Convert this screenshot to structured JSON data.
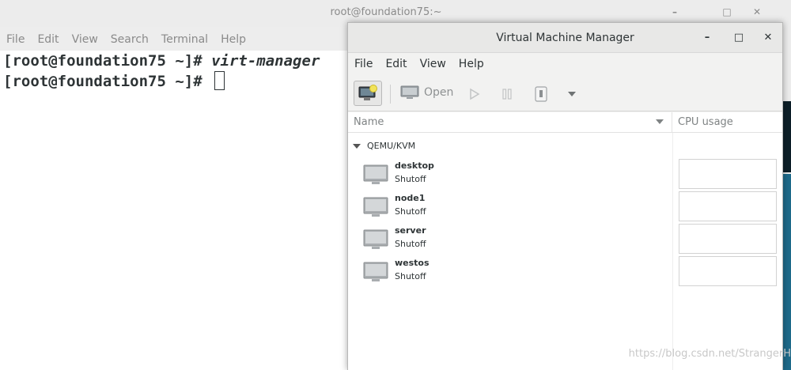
{
  "terminal": {
    "title": "root@foundation75:~",
    "menu": [
      "File",
      "Edit",
      "View",
      "Search",
      "Terminal",
      "Help"
    ],
    "lines": [
      {
        "prompt": "[root@foundation75 ~]# ",
        "command": "virt-manager"
      },
      {
        "prompt": "[root@foundation75 ~]# ",
        "command": ""
      }
    ],
    "controls": {
      "minimize": "–",
      "maximize": "□",
      "close": "✕"
    }
  },
  "vmm": {
    "title": "Virtual Machine Manager",
    "menu": [
      "File",
      "Edit",
      "View",
      "Help"
    ],
    "controls": {
      "minimize": "–",
      "maximize": "□",
      "close": "✕"
    },
    "toolbar": {
      "open_label": "Open"
    },
    "columns": {
      "name": "Name",
      "cpu": "CPU usage"
    },
    "connection": "QEMU/KVM",
    "vms": [
      {
        "name": "desktop",
        "state": "Shutoff"
      },
      {
        "name": "node1",
        "state": "Shutoff"
      },
      {
        "name": "server",
        "state": "Shutoff"
      },
      {
        "name": "westos",
        "state": "Shutoff"
      }
    ]
  },
  "watermark": "https://blog.csdn.net/StrangerH",
  "colors": {
    "terminal_text": "#2e3436",
    "window_bg": "#f2f2f1",
    "muted": "#8a8a8a"
  }
}
